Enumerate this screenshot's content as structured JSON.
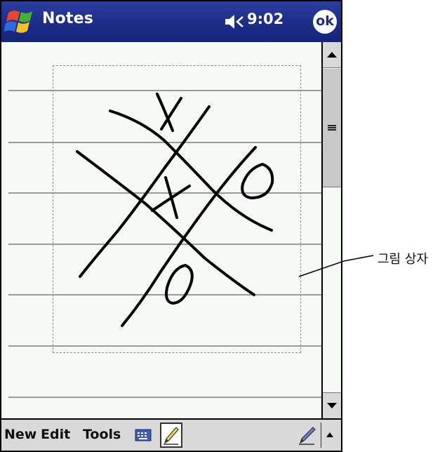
{
  "titlebar": {
    "app_title": "Notes",
    "clock": "9:02",
    "ok_label": "ok",
    "start_icon": "windows-flag-icon",
    "volume_icon": "speaker-icon"
  },
  "note": {
    "ruled_line_count": 7
  },
  "menubar": {
    "new_label": "New",
    "edit_label": "Edit",
    "tools_label": "Tools",
    "keyboard_icon": "keyboard-icon",
    "pen_icon": "pen-icon",
    "sip_icon": "chevron-up-icon"
  },
  "callout": {
    "label": "그림 상자"
  },
  "colors": {
    "titlebar": "#1b2b86",
    "paper": "#f6faf4",
    "menubar": "#d9d9d9"
  }
}
